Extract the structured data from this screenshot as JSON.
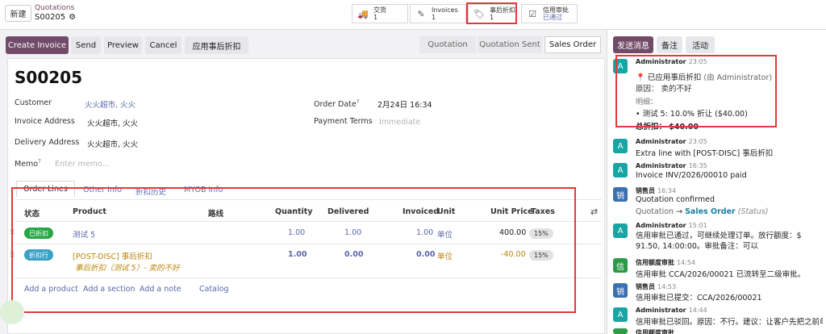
{
  "topbar": {
    "new_label": "新建",
    "breadcrumb_parent": "Quotations",
    "breadcrumb_current": "S00205",
    "smart_buttons": [
      {
        "label": "交货",
        "value": "1",
        "icon": "truck-icon"
      },
      {
        "label": "Invoices",
        "value": "1",
        "icon": "edit-icon"
      },
      {
        "label": "事后折扣",
        "value": "1",
        "icon": "tag-icon"
      },
      {
        "label": "信用审批",
        "value": "已通过",
        "icon": "check-icon"
      }
    ]
  },
  "actions": {
    "create_invoice": "Create Invoice",
    "send": "Send",
    "preview": "Preview",
    "cancel": "Cancel",
    "apply_discount": "应用事后折扣"
  },
  "statusbar": [
    "Quotation",
    "Quotation Sent",
    "Sales Order"
  ],
  "form": {
    "name": "S00205",
    "customer_label": "Customer",
    "customer": "火火超市, 火火",
    "invoice_address_label": "Invoice Address",
    "invoice_address": "火火超市, 火火",
    "delivery_address_label": "Delivery Address",
    "delivery_address": "火火超市, 火火",
    "memo_label": "Memo",
    "memo_help": "?",
    "memo_placeholder": "Enter memo...",
    "order_date_label": "Order Date",
    "order_date_help": "?",
    "order_date": "2月24日 16:34",
    "payment_terms_label": "Payment Terms",
    "payment_terms_placeholder": "Immediate"
  },
  "tabs": [
    "Order Lines",
    "Other Info",
    "折扣历史",
    "MYOB Info"
  ],
  "table": {
    "headers": {
      "status": "状态",
      "product": "Product",
      "route": "路线",
      "quantity": "Quantity",
      "delivered": "Delivered",
      "invoiced": "Invoiced",
      "unit": "Unit",
      "unit_price": "Unit Price",
      "taxes": "Taxes"
    },
    "rows": [
      {
        "status": "已折扣",
        "product": "测试 5",
        "quantity": "1.00",
        "delivered": "1.00",
        "invoiced": "1.00",
        "unit": "单位",
        "unit_price": "400.00",
        "tax": "15%"
      },
      {
        "status": "折扣行",
        "product": "[POST-DISC] 事后折扣",
        "desc": "事后折扣（测试 5）- 卖的不好",
        "quantity": "1.00",
        "delivered": "0.00",
        "invoiced": "0.00",
        "unit": "单位",
        "unit_price": "-40.00",
        "tax": "15%"
      }
    ],
    "add_product": "Add a product",
    "add_section": "Add a section",
    "add_note": "Add a note",
    "catalog": "Catalog"
  },
  "chatter": {
    "send_message": "发送消息",
    "note": "备注",
    "activity": "活动",
    "messages": [
      {
        "avatar": "A",
        "color": "#1aa5a5",
        "author": "Administrator",
        "time": "23:05",
        "lines": [
          "📍 已应用事后折扣",
          "(由 Administrator)",
          "原因： 卖的不好",
          "明细：",
          "• 测试 5: 10.0% 折让 ($40.00)",
          "总折扣： $40.00"
        ]
      },
      {
        "avatar": "A",
        "color": "#1aa5a5",
        "author": "Administrator",
        "time": "23:05",
        "lines": [
          "Extra line with [POST-DISC] 事后折扣"
        ]
      },
      {
        "avatar": "A",
        "color": "#1aa5a5",
        "author": "Administrator",
        "time": "16:35",
        "lines": [
          "Invoice INV/2026/00010 paid"
        ]
      },
      {
        "avatar": "销",
        "color": "#3b6fb0",
        "author": "销售员",
        "time": "16:34",
        "lines": [
          "Quotation confirmed",
          "Quotation",
          "→",
          "Sales Order",
          "(Status)"
        ]
      },
      {
        "avatar": "A",
        "color": "#1aa5a5",
        "author": "Administrator",
        "time": "15:01",
        "lines": [
          "信用审批已通过，可继续处理订单。放行额度：$ 91.50, 14:00:00。审批备注：可以"
        ]
      },
      {
        "avatar": "信",
        "color": "#2e9a48",
        "author": "信用额度审批",
        "time": "14:54",
        "lines": [
          "信用审批 CCA/2026/00021 已流转至二级审批。"
        ]
      },
      {
        "avatar": "销",
        "color": "#3b6fb0",
        "author": "销售员",
        "time": "14:53",
        "lines": [
          "信用审批已提交：CCA/2026/00021"
        ]
      },
      {
        "avatar": "A",
        "color": "#1aa5a5",
        "author": "Administrator",
        "time": "14:44",
        "lines": [
          "信用审批已驳回。原因：不行。建议：让客户先把之前单"
        ]
      },
      {
        "avatar": "信",
        "color": "#2e9a48",
        "author": "信用额度审批",
        "time": "",
        "lines": []
      }
    ]
  },
  "colors": {
    "brand": "#714b67",
    "highlight": "#e03b3b",
    "link": "#5b67a8",
    "green": "#28a745"
  }
}
